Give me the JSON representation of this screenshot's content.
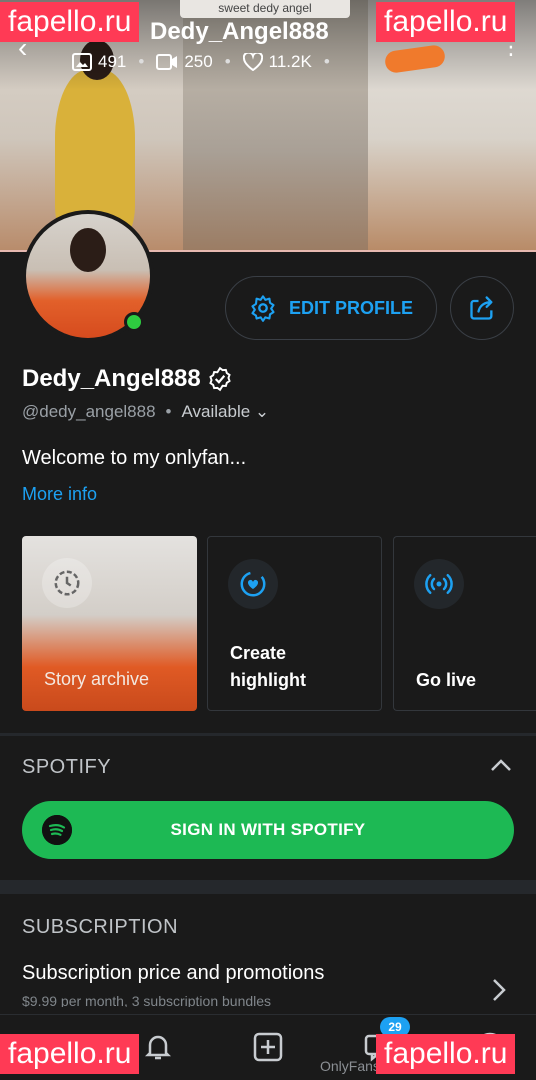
{
  "cover": {
    "caption": "sweet dedy angel",
    "title": "Dedy_Angel888",
    "stats": {
      "photos": "491",
      "videos": "250",
      "likes": "11.2K"
    }
  },
  "watermark": "fapello.ru",
  "profile": {
    "display_name": "Dedy_Angel888",
    "handle": "@dedy_angel888",
    "status": "Available",
    "bio": "Welcome to my onlyfan...",
    "more_info": "More info",
    "edit_button": "EDIT PROFILE"
  },
  "highlights": [
    {
      "label": "Story archive"
    },
    {
      "label": "Create highlight"
    },
    {
      "label": "Go live"
    }
  ],
  "spotify": {
    "section_title": "SPOTIFY",
    "button": "SIGN IN WITH SPOTIFY"
  },
  "subscription": {
    "section_title": "SUBSCRIPTION",
    "item_title": "Subscription price and promotions",
    "item_desc": "$9.99 per month, 3 subscription bundles"
  },
  "nav": {
    "messages_badge": "29"
  },
  "footer": {
    "url": "OnlyFans.com/dedy_angel888"
  },
  "colors": {
    "accent": "#1da1f2",
    "spotify_green": "#1db954",
    "online": "#2ecc40",
    "watermark_bg": "#ff3a55"
  },
  "icons": {
    "back": "arrow-left-icon",
    "photos": "image-icon",
    "videos": "video-icon",
    "likes": "heart-icon",
    "menu": "more-vertical-icon",
    "settings": "gear-icon",
    "share": "share-icon"
  }
}
